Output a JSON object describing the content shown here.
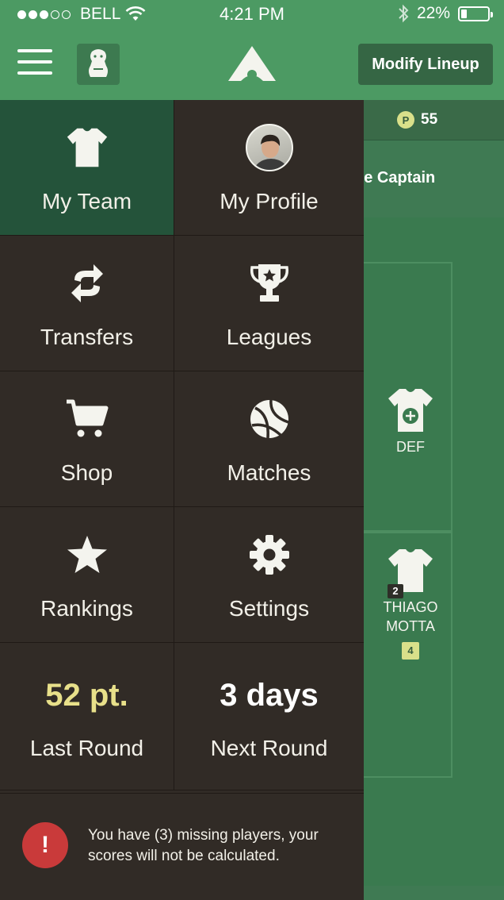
{
  "status_bar": {
    "carrier": "BELL",
    "time": "4:21 PM",
    "battery": "22%",
    "battery_level": 0.22
  },
  "header": {
    "modify_button": "Modify Lineup"
  },
  "team_view": {
    "points_coin": "P",
    "points": "55",
    "captain_text": "Change Captain",
    "slots": [
      {
        "label": "DEF"
      },
      {
        "name_line1": "THIAGO",
        "name_line2": "MOTTA",
        "number": "2",
        "score": "4"
      }
    ]
  },
  "menu": {
    "items": [
      {
        "label": "My Team",
        "icon": "shirt-icon",
        "active": true
      },
      {
        "label": "My Profile",
        "icon": "avatar"
      },
      {
        "label": "Transfers",
        "icon": "swap-icon"
      },
      {
        "label": "Leagues",
        "icon": "trophy-icon"
      },
      {
        "label": "Shop",
        "icon": "cart-icon"
      },
      {
        "label": "Matches",
        "icon": "ball-icon"
      },
      {
        "label": "Rankings",
        "icon": "star-icon"
      },
      {
        "label": "Settings",
        "icon": "gear-icon"
      }
    ],
    "last_round": {
      "value": "52 pt.",
      "label": "Last Round"
    },
    "next_round": {
      "value": "3 days",
      "label": "Next Round"
    }
  },
  "alert": {
    "icon_text": "!",
    "message": "You have (3) missing players, your scores will not be calculated."
  },
  "colors": {
    "header_green": "#4c9a63",
    "drawer_bg": "#312b26",
    "active_green": "#24533a",
    "alert_red": "#c93a3a",
    "accent_yellow": "#e8e08a"
  }
}
